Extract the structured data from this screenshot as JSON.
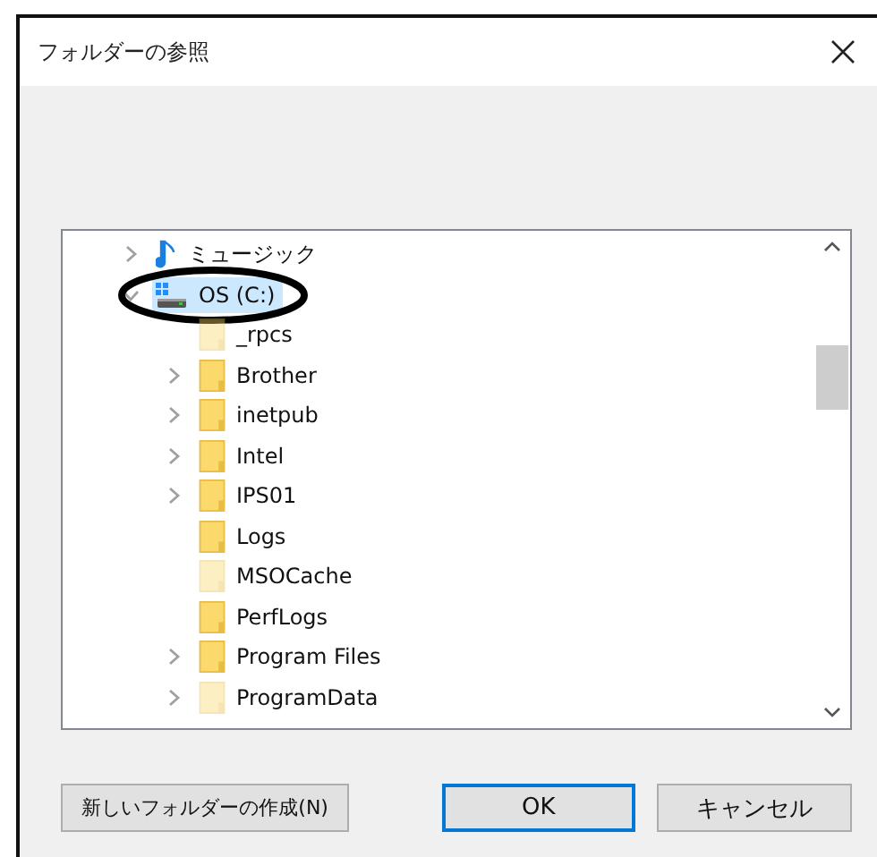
{
  "window": {
    "title": "フォルダーの参照"
  },
  "tree": [
    {
      "label": "ミュージック",
      "kind": "music",
      "has_children": true,
      "expanded": false,
      "selected": false,
      "circled": false
    },
    {
      "label": "OS (C:)",
      "kind": "drive",
      "has_children": true,
      "expanded": true,
      "selected": true,
      "circled": true,
      "children": [
        {
          "label": "_rpcs",
          "kind": "folder",
          "hidden": true,
          "has_children": false,
          "expanded": false,
          "selected": false
        },
        {
          "label": "Brother",
          "kind": "folder",
          "hidden": false,
          "has_children": true,
          "expanded": false,
          "selected": false
        },
        {
          "label": "inetpub",
          "kind": "folder",
          "hidden": false,
          "has_children": true,
          "expanded": false,
          "selected": false
        },
        {
          "label": "Intel",
          "kind": "folder",
          "hidden": false,
          "has_children": true,
          "expanded": false,
          "selected": false
        },
        {
          "label": "IPS01",
          "kind": "folder",
          "hidden": false,
          "has_children": true,
          "expanded": false,
          "selected": false
        },
        {
          "label": "Logs",
          "kind": "folder",
          "hidden": false,
          "has_children": false,
          "expanded": false,
          "selected": false
        },
        {
          "label": "MSOCache",
          "kind": "folder",
          "hidden": true,
          "has_children": false,
          "expanded": false,
          "selected": false
        },
        {
          "label": "PerfLogs",
          "kind": "folder",
          "hidden": false,
          "has_children": false,
          "expanded": false,
          "selected": false
        },
        {
          "label": "Program Files",
          "kind": "folder",
          "hidden": false,
          "has_children": true,
          "expanded": false,
          "selected": false
        },
        {
          "label": "ProgramData",
          "kind": "folder",
          "hidden": true,
          "has_children": true,
          "expanded": false,
          "selected": false
        }
      ]
    }
  ],
  "buttons": [
    {
      "label": "新しいフォルダーの作成(N)",
      "default": false
    },
    {
      "label": "OK",
      "default": true
    },
    {
      "label": "キャンセル",
      "default": false
    }
  ]
}
